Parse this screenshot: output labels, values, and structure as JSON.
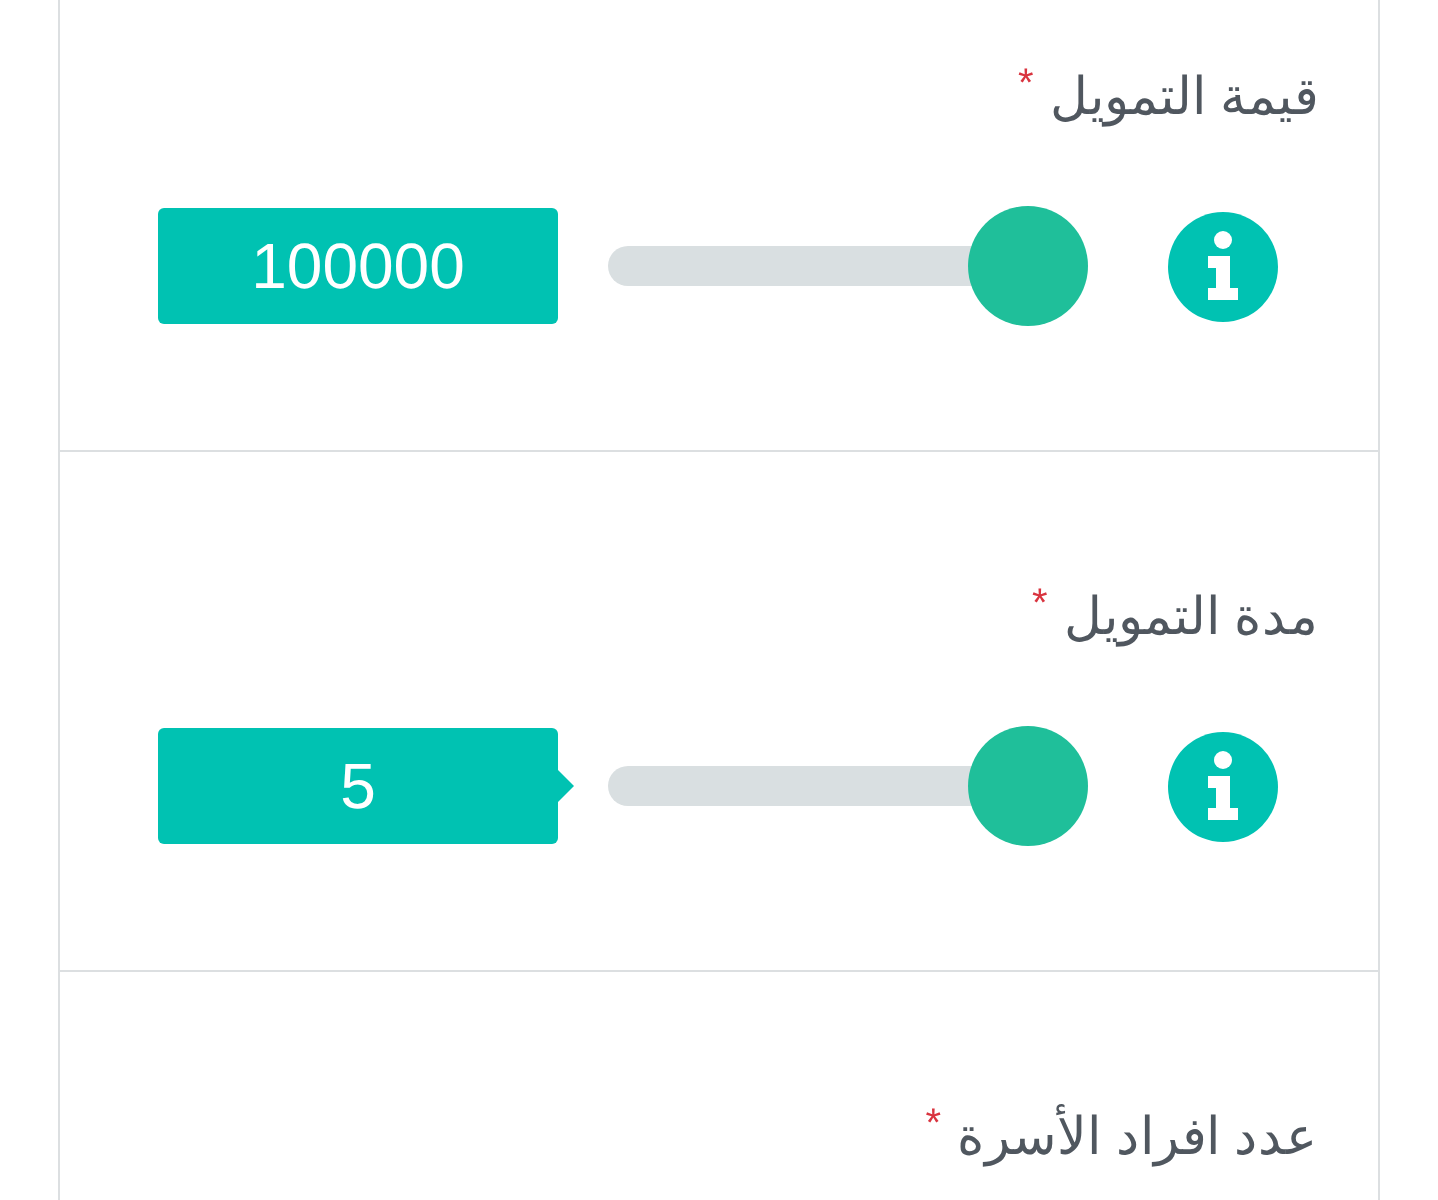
{
  "fields": [
    {
      "label": "قيمة التمويل",
      "required_mark": "*",
      "value": "100000",
      "level": 1,
      "arrow": false
    },
    {
      "label": "مدة التمويل",
      "required_mark": "*",
      "value": "5",
      "level": 1,
      "arrow": true
    },
    {
      "label": "عدد افراد الأسرة",
      "required_mark": "*"
    }
  ]
}
